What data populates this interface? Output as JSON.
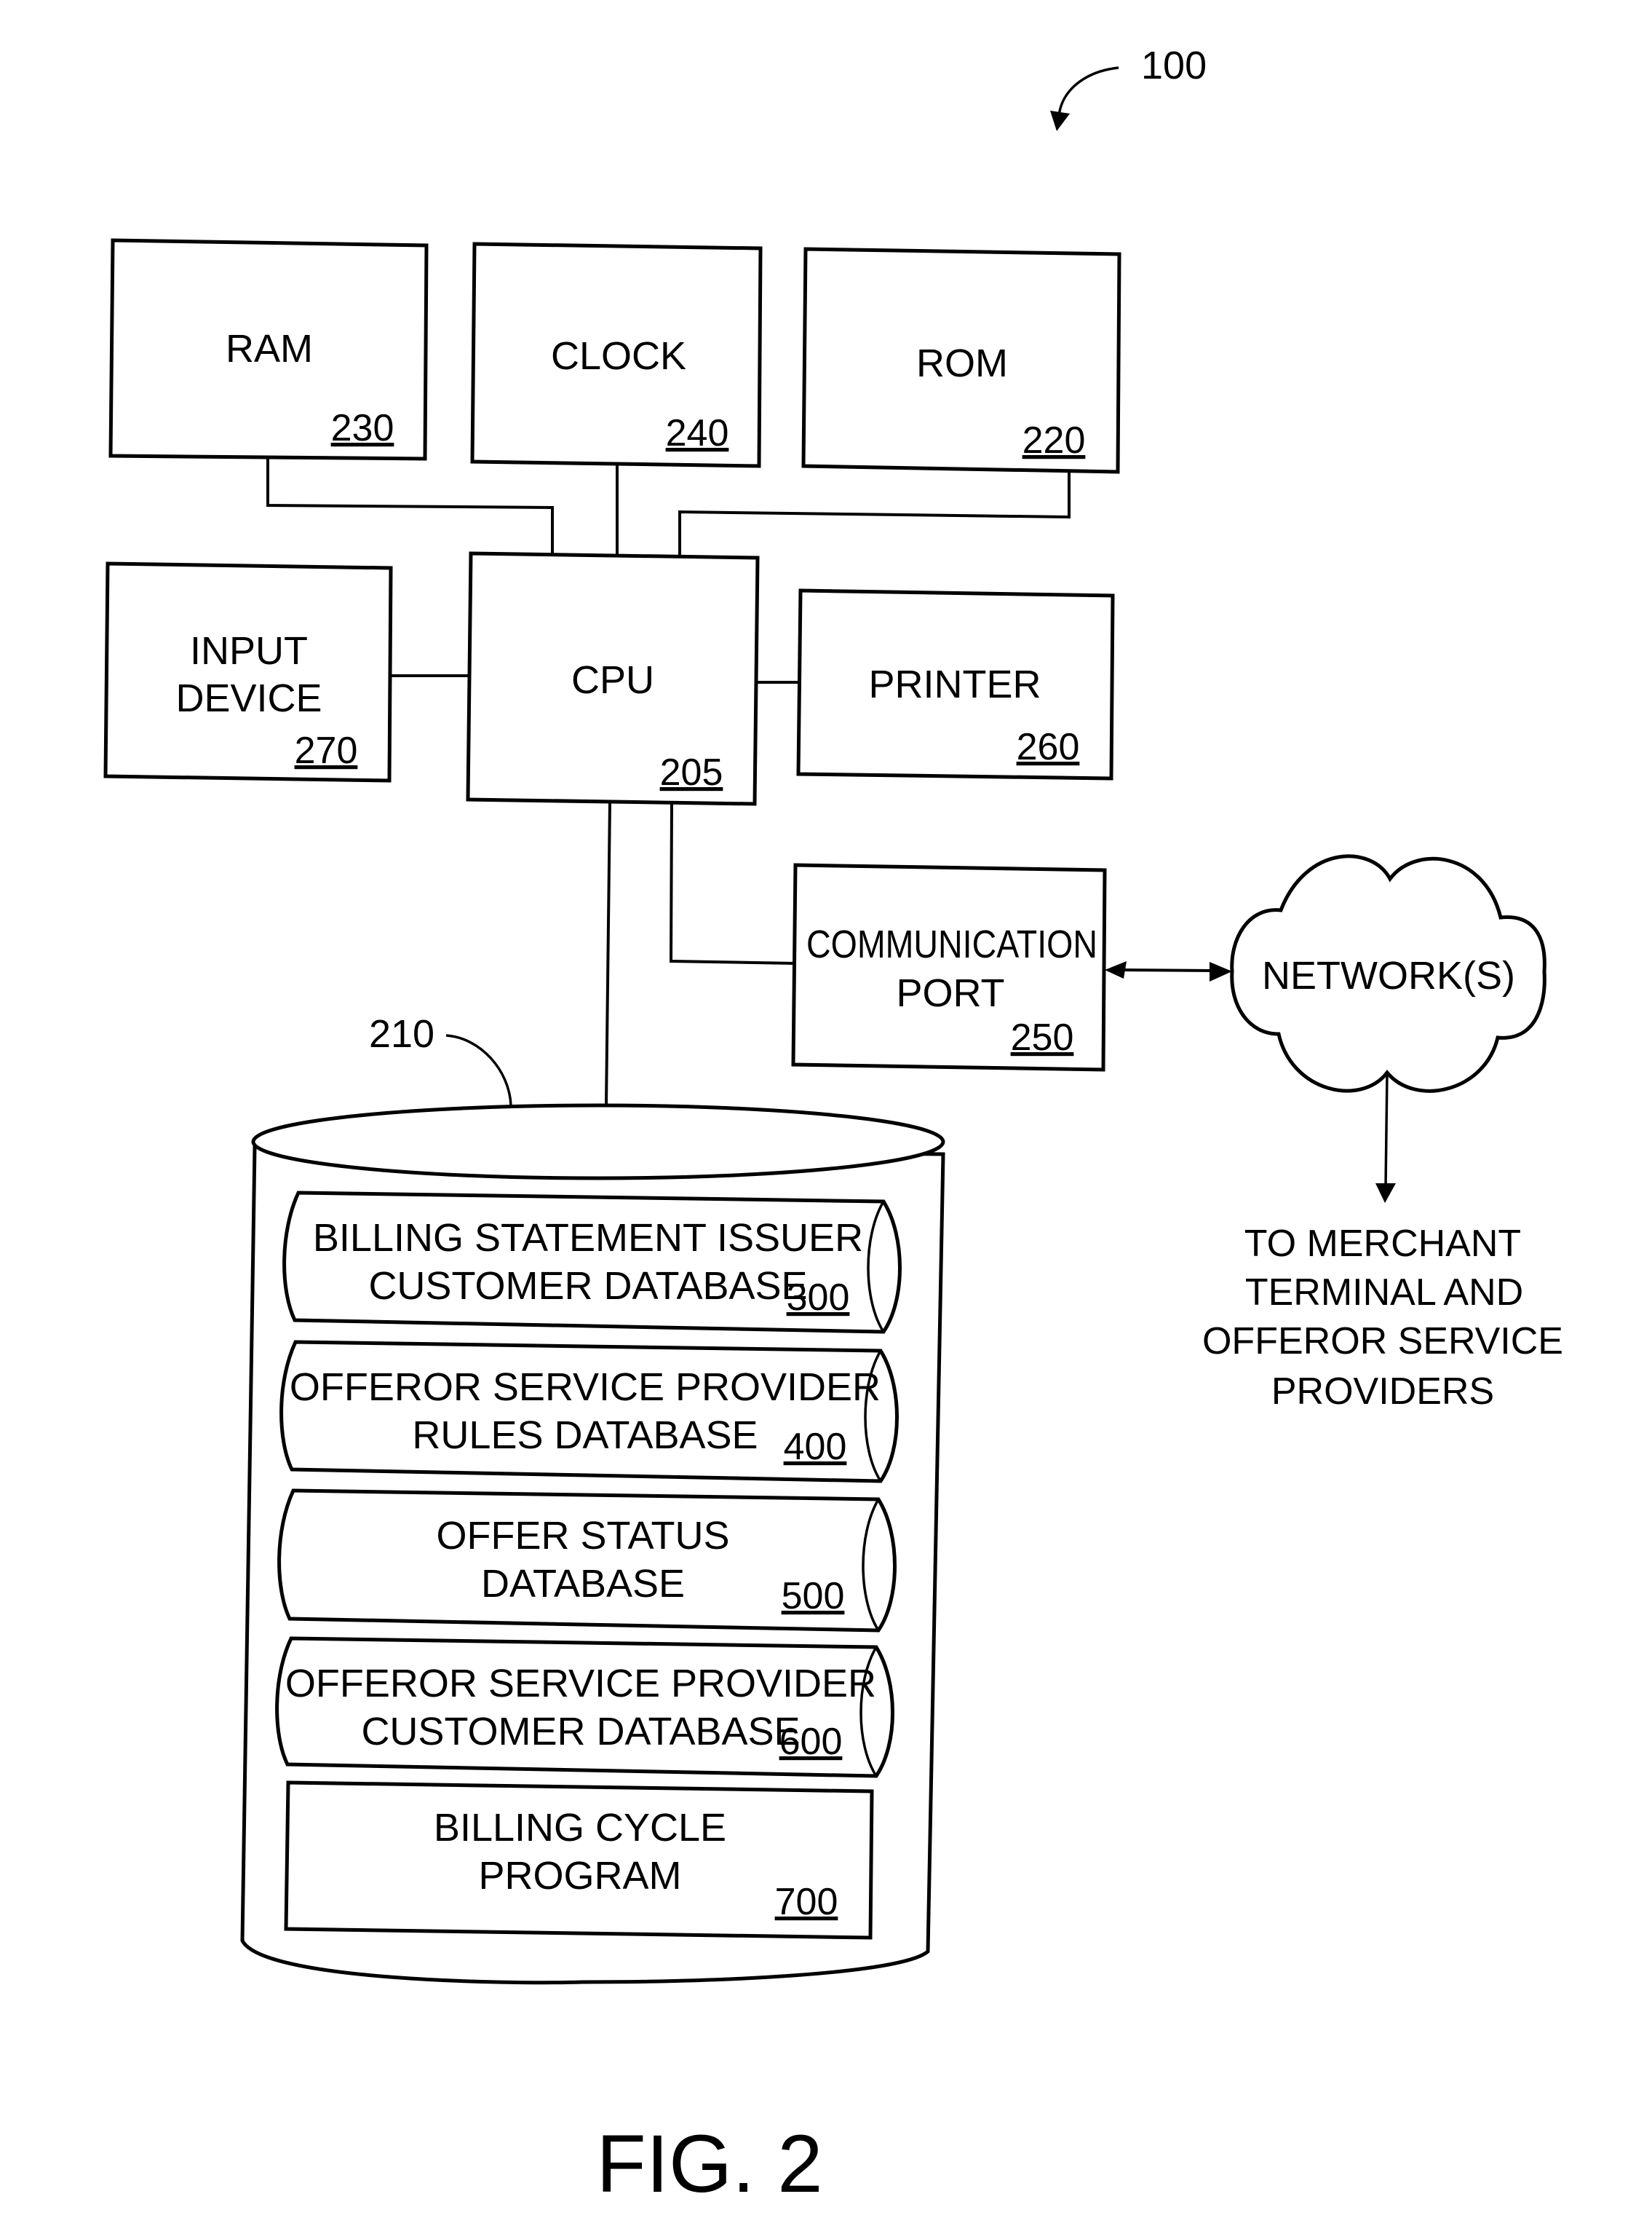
{
  "figure": {
    "system_ref": "100",
    "caption": "FIG. 2"
  },
  "components": {
    "ram": {
      "label": [
        "RAM"
      ],
      "ref": "230"
    },
    "clock": {
      "label": [
        "CLOCK"
      ],
      "ref": "240"
    },
    "rom": {
      "label": [
        "ROM"
      ],
      "ref": "220"
    },
    "input_device": {
      "label": [
        "INPUT",
        "DEVICE"
      ],
      "ref": "270"
    },
    "cpu": {
      "label": [
        "CPU"
      ],
      "ref": "205"
    },
    "printer": {
      "label": [
        "PRINTER"
      ],
      "ref": "260"
    },
    "communication_port": {
      "label": [
        "COMMUNICATION",
        "PORT"
      ],
      "ref": "250"
    },
    "network": {
      "label": [
        "NETWORK(S)"
      ]
    }
  },
  "storage": {
    "ref": "210",
    "items": [
      {
        "label": [
          "BILLING STATEMENT ISSUER",
          "CUSTOMER DATABASE"
        ],
        "ref": "300",
        "kind": "database"
      },
      {
        "label": [
          "OFFEROR SERVICE PROVIDER",
          "RULES DATABASE"
        ],
        "ref": "400",
        "kind": "database"
      },
      {
        "label": [
          "OFFER STATUS",
          "DATABASE"
        ],
        "ref": "500",
        "kind": "database"
      },
      {
        "label": [
          "OFFEROR SERVICE PROVIDER",
          "CUSTOMER DATABASE"
        ],
        "ref": "600",
        "kind": "database"
      },
      {
        "label": [
          "BILLING CYCLE",
          "PROGRAM"
        ],
        "ref": "700",
        "kind": "program"
      }
    ]
  },
  "external": {
    "destination": [
      "TO MERCHANT",
      "TERMINAL AND",
      "OFFEROR SERVICE",
      "PROVIDERS"
    ]
  }
}
